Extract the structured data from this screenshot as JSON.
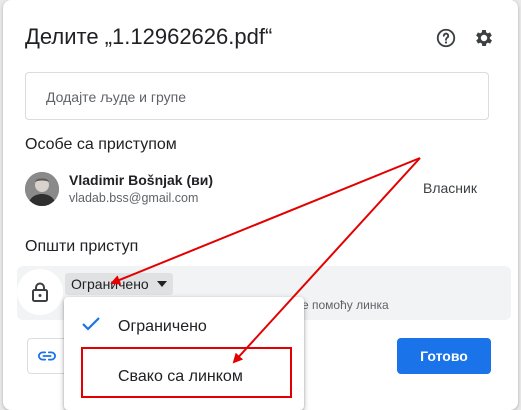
{
  "dialog": {
    "title": "Делите „1.12962626.pdf“",
    "help_icon": "help-circle-icon",
    "settings_icon": "gear-icon"
  },
  "add_people": {
    "placeholder": "Додајте људе и групе"
  },
  "people_with_access": {
    "heading": "Особе са приступом",
    "people": [
      {
        "name": "Vladimir Bošnjak (ви)",
        "email": "vladab.bss@gmail.com",
        "role": "Власник"
      }
    ]
  },
  "general_access": {
    "heading": "Општи приступ",
    "selected": "Ограничено",
    "description_partial": "е помоћу линка"
  },
  "access_menu": {
    "options": [
      {
        "label": "Ограничено",
        "selected": true
      },
      {
        "label": "Свако са линком",
        "selected": false
      }
    ]
  },
  "footer": {
    "copy_link_icon": "link-icon",
    "done_label": "Готово"
  },
  "colors": {
    "accent": "#1a73e8",
    "annotation": "#e30000"
  }
}
